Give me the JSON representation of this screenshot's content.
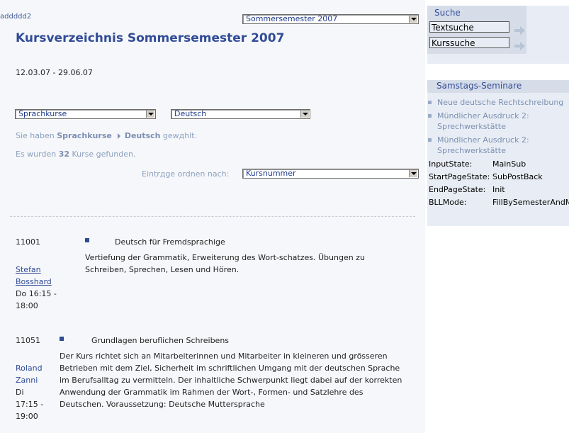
{
  "top_code": "addddd2",
  "semester_select": "Sommersemester 2007",
  "title": "Kursverzeichnis Sommersemester 2007",
  "dates": "12.03.07 - 29.06.07",
  "filters": {
    "category": "Sprachkurse",
    "language": "Deutsch"
  },
  "chosen": {
    "prefix": "Sie haben",
    "category": "Sprachkurse",
    "language": "Deutsch",
    "suffix": "gewдhlt."
  },
  "found": {
    "prefix": "Es wurden",
    "count": "32",
    "suffix": "Kurse gefunden."
  },
  "sort": {
    "label": "Eintrдge ordnen nach:",
    "value": "Kursnummer"
  },
  "courses": [
    {
      "number": "11001",
      "teacher_first": "Stefan",
      "teacher_last": "Bosshard",
      "day_time": "Do 16:15 -",
      "end": "18:00",
      "title": "Deutsch für Fremdsprachige",
      "desc1": "Vertiefung der Grammatik, Erweiterung des Wort-schatzes. Übungen zu",
      "desc2": "Schreiben, Sprechen, Lesen und Hören."
    },
    {
      "number": "11051",
      "teacher_first": "Roland",
      "teacher_last": "Zanni",
      "day": "Di",
      "time": "17:15 -",
      "end": "19:00",
      "title": "Grundlagen beruflichen Schreibens",
      "desc": [
        "Der Kurs richtet sich an Mitarbeiterinnen und Mitarbeiter in kleineren und grösseren",
        "Betrieben mit dem Ziel, Sicherheit im schriftlichen Umgang mit der deutschen Sprache",
        "im Berufsalltag zu vermitteln. Der inhaltliche Schwerpunkt liegt dabei auf der korrekten",
        "Anwendung der Grammatik im Rahmen der Wort-, Formen- und Satzlehre des",
        "Deutschen. Voraussetzung: Deutsche Muttersprache"
      ]
    }
  ],
  "sidebar": {
    "search_title": "Suche",
    "text_search": "Textsuche",
    "course_search": "Kurssuche",
    "seminars_title": "Samstags-Seminare",
    "seminars": [
      {
        "line1": "Neue deutsche Rechtschreibung"
      },
      {
        "line1": "Mündlicher Ausdruck 2:",
        "line2": "Sprechwerkstätte"
      },
      {
        "line1": "Mündlicher Ausdruck 2:",
        "line2": "Sprechwerkstätte"
      }
    ],
    "states": [
      {
        "key": "InputState:",
        "value": "MainSub"
      },
      {
        "key": "StartPageState:",
        "value": "SubPostBack"
      },
      {
        "key": "EndPageState:",
        "value": "Init"
      },
      {
        "key": "BLLMode:",
        "value": "FillBySemesterAndM"
      }
    ]
  }
}
